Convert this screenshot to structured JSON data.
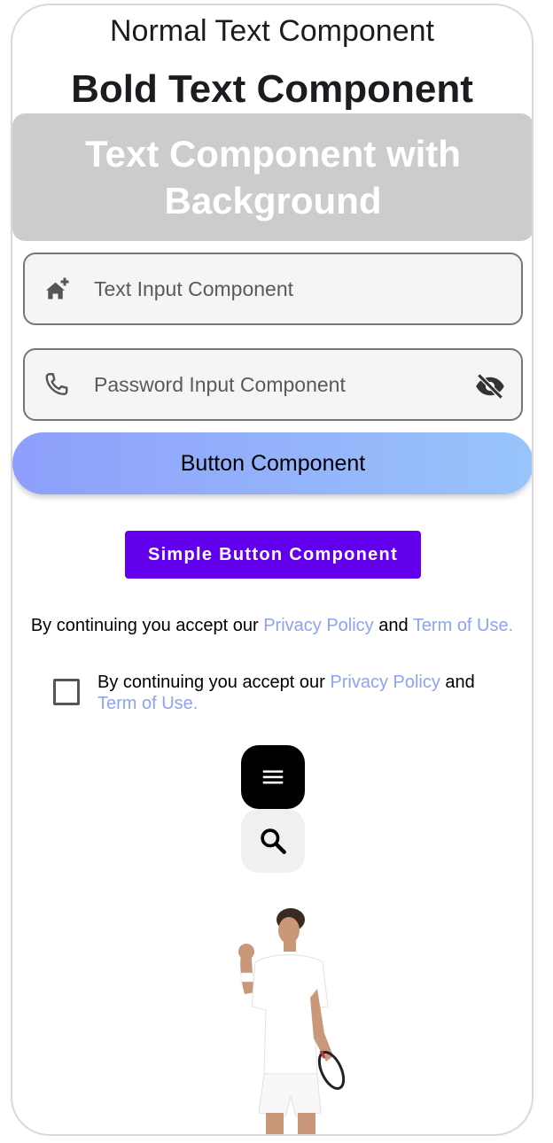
{
  "texts": {
    "normal": "Normal Text Component",
    "bold": "Bold Text Component",
    "background": "Text Component with Background"
  },
  "text_input": {
    "placeholder": "Text Input Component",
    "icon": "home-add-icon"
  },
  "password_input": {
    "placeholder": "Password Input Component",
    "icon": "phone-icon",
    "trailing_icon": "visibility-off-icon"
  },
  "buttons": {
    "gradient": "Button Component",
    "simple": "Simple Button Component"
  },
  "terms": {
    "prefix": "By continuing you accept our ",
    "privacy": "Privacy Policy",
    "and": " and ",
    "terms": "Term of Use."
  },
  "checkbox_terms": {
    "checked": false,
    "prefix": "By continuing you accept our ",
    "privacy": "Privacy Policy",
    "and": " and ",
    "terms": "Term of Use."
  },
  "fabs": {
    "menu_icon": "menu-icon",
    "search_icon": "search-icon"
  },
  "image": {
    "subject": "tennis-player"
  },
  "colors": {
    "link": "#8ea2f7",
    "primary": "#6200ee",
    "gradient_start": "#8e9ffb",
    "gradient_end": "#99c4fb",
    "background_box": "#cccccc"
  }
}
